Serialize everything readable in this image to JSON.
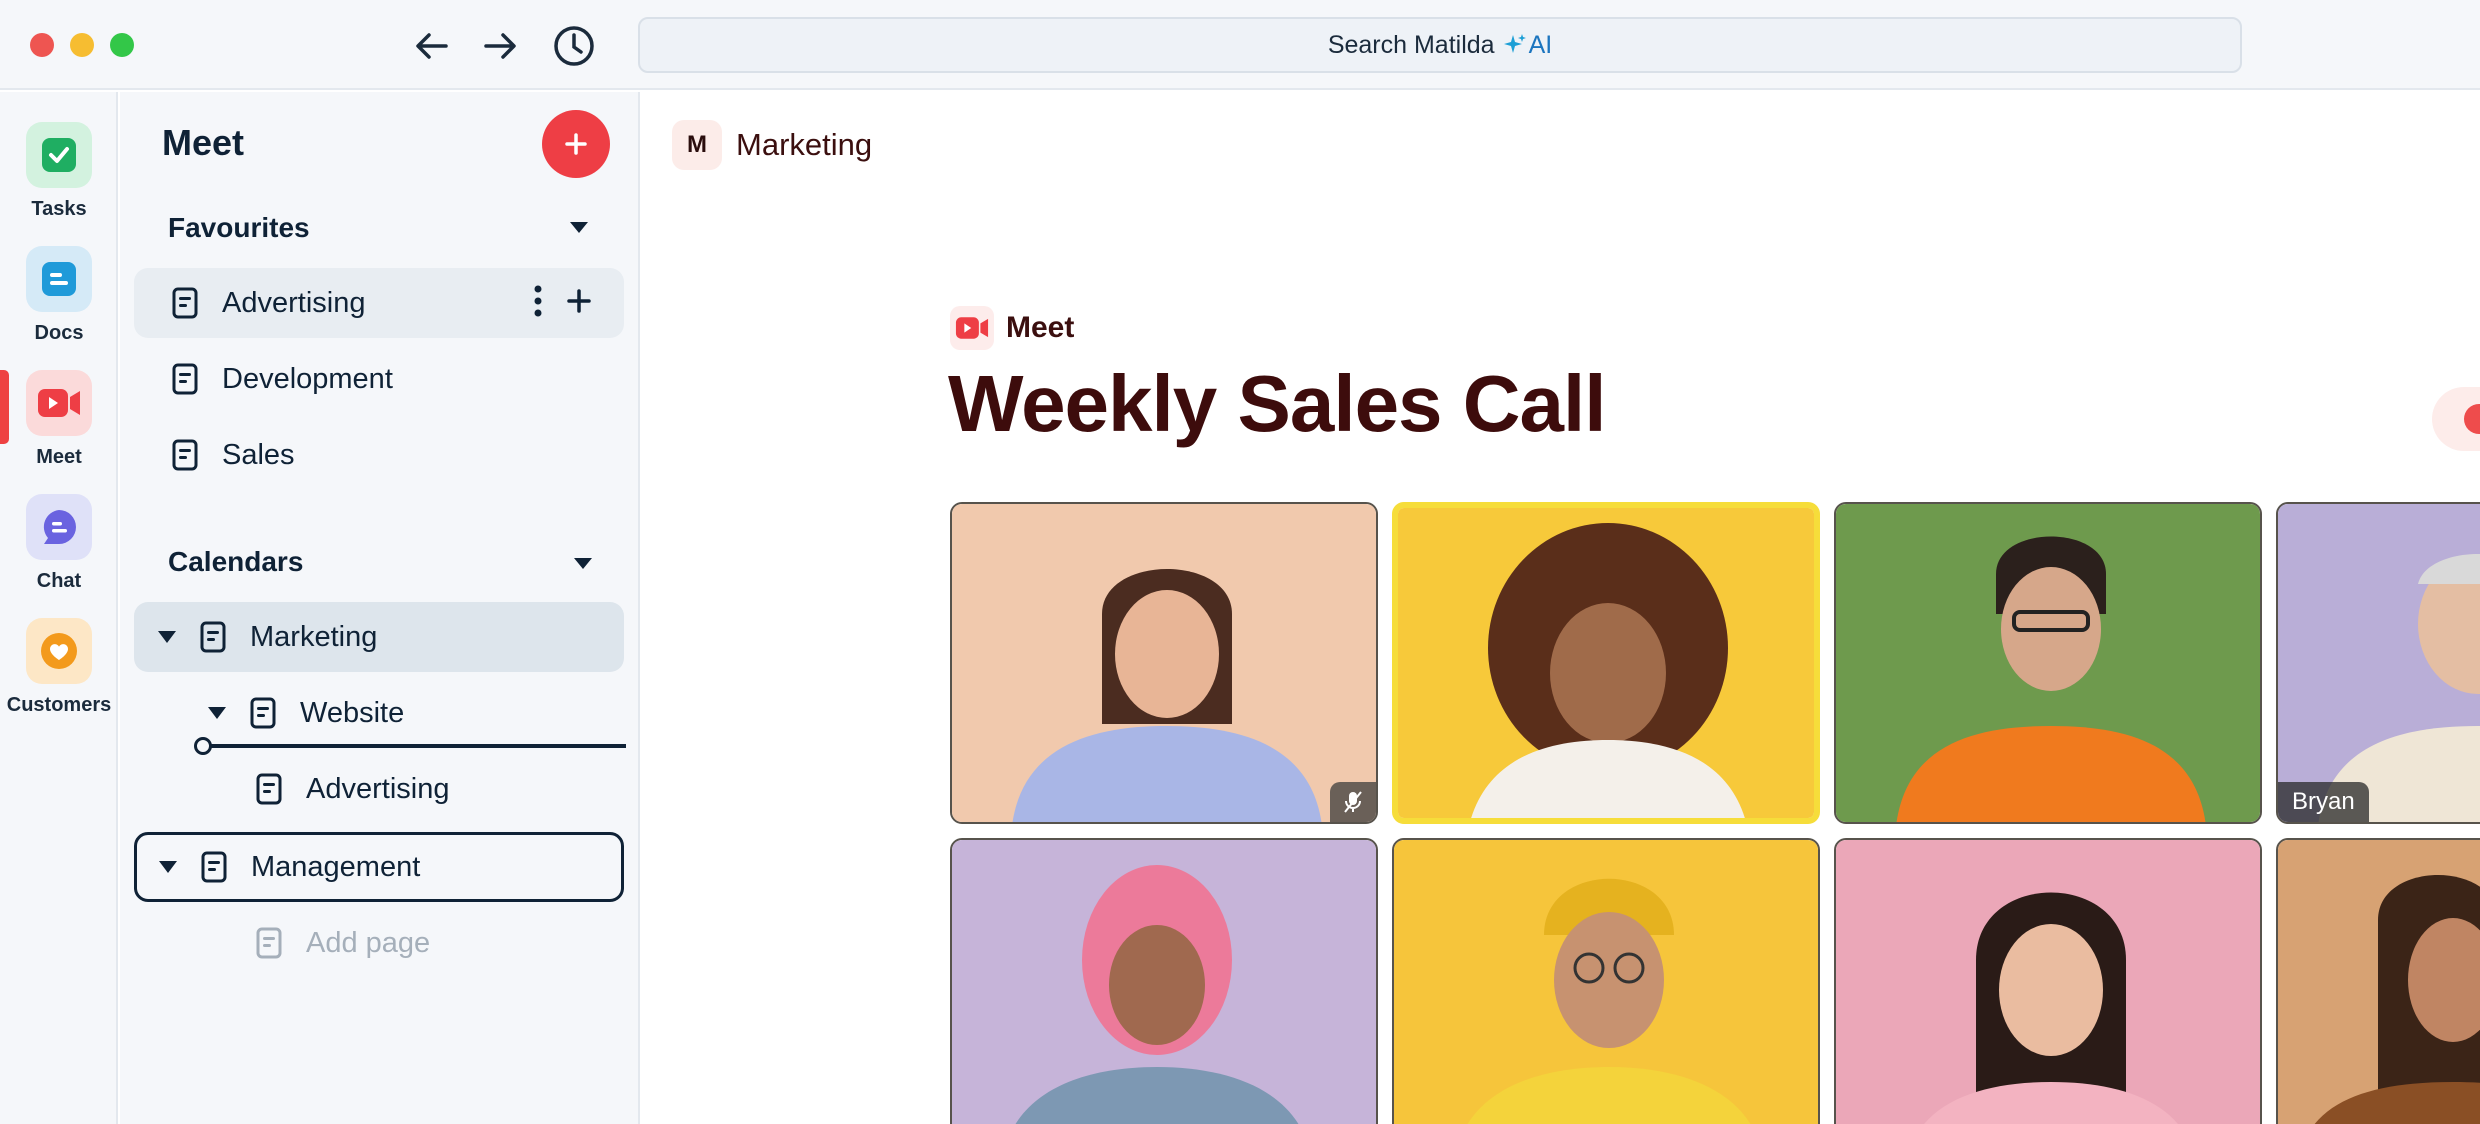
{
  "titlebar": {
    "search_placeholder": "Search Matilda",
    "search_ai_label": "AI"
  },
  "rail": {
    "items": [
      {
        "label": "Tasks",
        "icon": "tasks-icon"
      },
      {
        "label": "Docs",
        "icon": "docs-icon"
      },
      {
        "label": "Meet",
        "icon": "meet-icon",
        "active": true
      },
      {
        "label": "Chat",
        "icon": "chat-icon"
      },
      {
        "label": "Customers",
        "icon": "customers-icon"
      }
    ]
  },
  "sidebar": {
    "title": "Meet",
    "favourites": {
      "heading": "Favourites",
      "items": [
        "Advertising",
        "Development",
        "Sales"
      ]
    },
    "calendars": {
      "heading": "Calendars",
      "marketing": "Marketing",
      "website": "Website",
      "advertising": "Advertising",
      "management": "Management",
      "add_page": "Add page"
    }
  },
  "main": {
    "breadcrumb": {
      "badge": "M",
      "label": "Marketing"
    },
    "app_tag": "Meet",
    "title": "Weekly Sales Call",
    "participants": [
      {
        "name": "",
        "muted": true,
        "speaking": false,
        "bg": "#f1c9ad"
      },
      {
        "name": "",
        "muted": false,
        "speaking": true,
        "bg": "#f7c93a"
      },
      {
        "name": "",
        "muted": false,
        "speaking": false,
        "bg": "#6e9a4d"
      },
      {
        "name": "Bryan",
        "muted": false,
        "speaking": false,
        "bg": "#b9aed7"
      },
      {
        "name": "",
        "muted": false,
        "speaking": false,
        "bg": "#c6b4d9"
      },
      {
        "name": "",
        "muted": false,
        "speaking": false,
        "bg": "#f6c53b"
      },
      {
        "name": "",
        "muted": false,
        "speaking": false,
        "bg": "#eba7b8"
      },
      {
        "name": "",
        "muted": false,
        "speaking": false,
        "bg": "#d7a273"
      }
    ]
  },
  "colors": {
    "accent": "#ee3e45",
    "title": "#3d0c0c",
    "sidebar_text": "#0f2236"
  }
}
